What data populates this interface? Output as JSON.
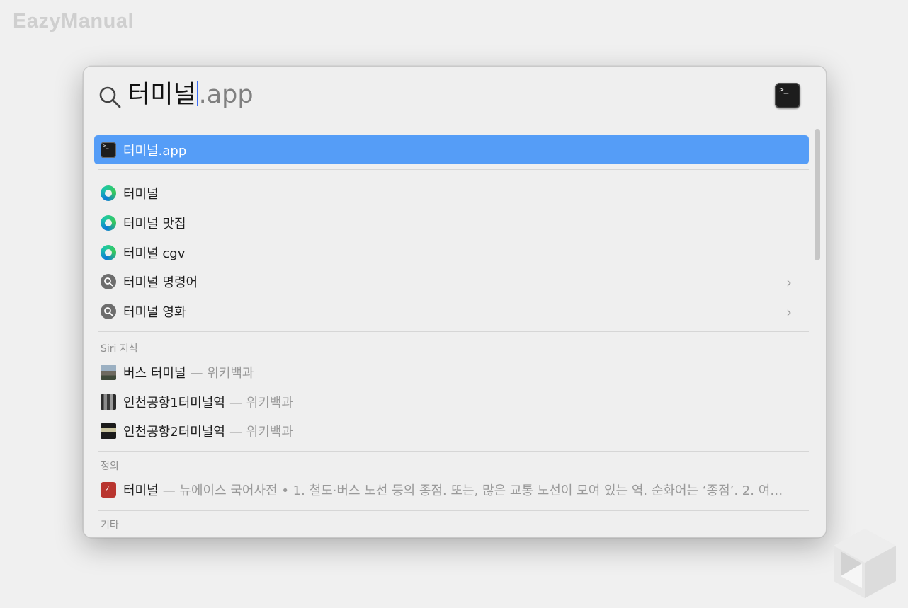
{
  "watermark": "EazyManual",
  "search": {
    "typed": "터미널",
    "completion": ".app",
    "app_icon": "terminal-icon",
    "search_icon": "magnifier-icon"
  },
  "top_hit": {
    "label": "터미널.app",
    "icon": "terminal-icon"
  },
  "web_suggestions": [
    {
      "label": "터미널",
      "icon": "edge-icon"
    },
    {
      "label": "터미널 맛집",
      "icon": "edge-icon"
    },
    {
      "label": "터미널 cgv",
      "icon": "edge-icon"
    },
    {
      "label": "터미널 명령어",
      "icon": "search-suggestion-icon",
      "chevron": "›"
    },
    {
      "label": "터미널 영화",
      "icon": "search-suggestion-icon",
      "chevron": "›"
    }
  ],
  "siri_section": {
    "title": "Siri 지식",
    "items": [
      {
        "label": "버스 터미널",
        "source": "— 위키백과"
      },
      {
        "label": "인천공항1터미널역",
        "source": "— 위키백과"
      },
      {
        "label": "인천공항2터미널역",
        "source": "— 위키백과"
      }
    ]
  },
  "definition_section": {
    "title": "정의",
    "item": {
      "label": "터미널",
      "detail": "— 뉴에이스 국어사전 • 1. 철도·버스 노선 등의 종점. 또는, 많은 교통 노선이 모여 있는 역. 순화어는 ‘종점’. 2. 여…",
      "icon_text": "가"
    }
  },
  "other_section": {
    "title": "기타"
  },
  "colors": {
    "selection": "#559df7",
    "background": "#f0f0f0"
  }
}
